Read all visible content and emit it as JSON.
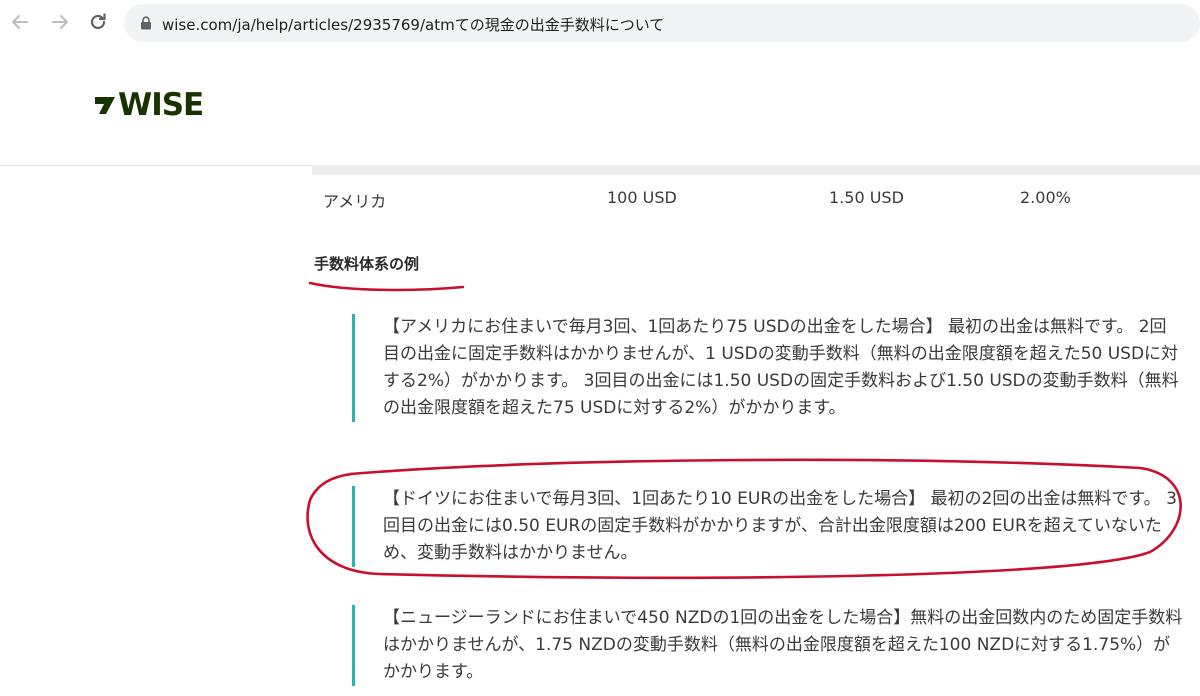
{
  "browser": {
    "url": "wise.com/ja/help/articles/2935769/atmての現金の出金手数料について"
  },
  "site": {
    "logo_text": "WISE",
    "brand_color": "#163300",
    "accent_color": "#2bb3b3"
  },
  "table": {
    "row": [
      "アメリカ",
      "100 USD",
      "1.50 USD",
      "2.00%"
    ]
  },
  "content": {
    "section_title": "手数料体系の例",
    "examples": [
      "【アメリカにお住まいで毎月3回、1回あたり75 USDの出金をした場合】 最初の出金は無料です。 2回目の出金に固定手数料はかかりませんが、1 USDの変動手数料（無料の出金限度額を超えた50 USDに対する2%）がかかります。 3回目の出金には1.50 USDの固定手数料および1.50 USDの変動手数料（無料の出金限度額を超えた75 USDに対する2%）がかかります。",
      "【ドイツにお住まいで毎月3回、1回あたり10 EURの出金をした場合】 最初の2回の出金は無料です。 3回目の出金には0.50 EURの固定手数料がかかりますが、合計出金限度額は200 EURを超えていないため、変動手数料はかかりません。",
      "【ニュージーランドにお住まいで450 NZDの1回の出金をした場合】無料の出金回数内のため固定手数料はかかりませんが、1.75 NZDの変動手数料（無料の出金限度額を超えた100 NZDに対する1.75%）がかかります。"
    ]
  },
  "annotation_color": "#c8102e"
}
